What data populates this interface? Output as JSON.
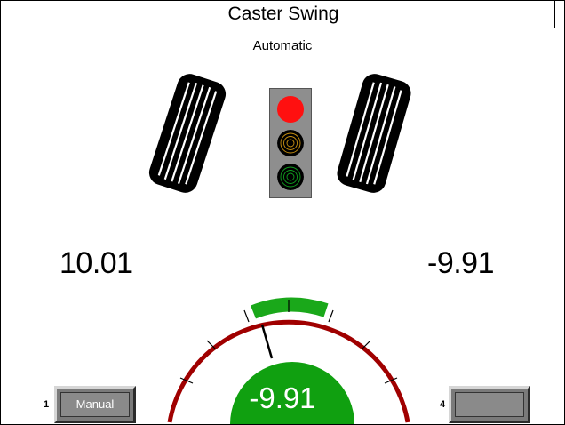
{
  "screen": {
    "title": "Caster Swing",
    "mode": "Automatic"
  },
  "traffic_light": {
    "active": "red",
    "colors": {
      "red": "#ff1010",
      "yellow_rings": "#c89010",
      "green_rings": "#10a020"
    }
  },
  "readings": {
    "left": "10.01",
    "right": "-9.91"
  },
  "gauge": {
    "value_label": "-9.91",
    "value": -9.91,
    "colors": {
      "arc": "#a00000",
      "target_band": "#1aa81a",
      "value_dome": "#10a010"
    }
  },
  "softkeys": [
    {
      "number": "1",
      "label": "Manual"
    },
    {
      "number": "4",
      "label": ""
    }
  ]
}
